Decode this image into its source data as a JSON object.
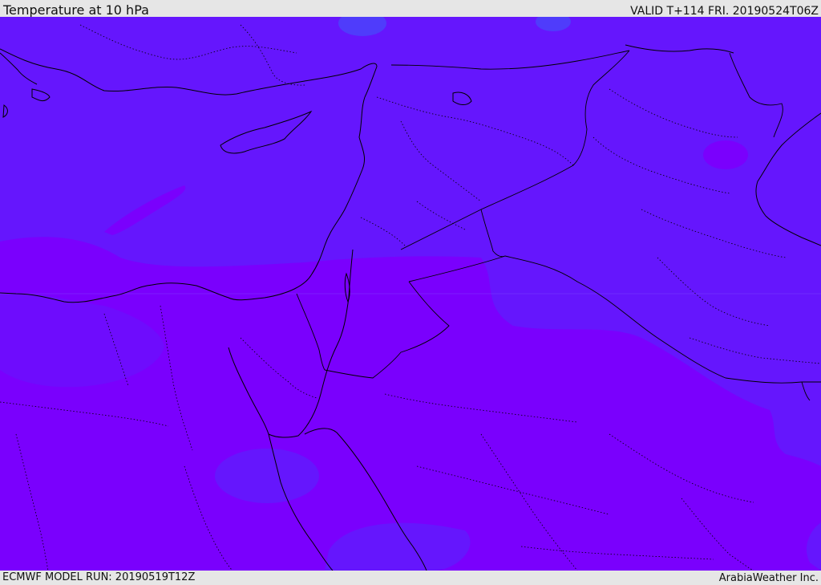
{
  "header": {
    "title": "Temperature at 10 hPa",
    "valid": "VALID T+114 FRI. 20190524T06Z"
  },
  "footer": {
    "model_run": "ECMWF MODEL RUN: 20190519T12Z",
    "credit": "ArabiaWeather Inc."
  },
  "map": {
    "colors": {
      "cool_band": "#6516fd",
      "warm_band": "#7a00fd",
      "mid_band": "#6e0cfd",
      "cold_patch": "#4f3cfb",
      "borders": "#000000"
    }
  }
}
